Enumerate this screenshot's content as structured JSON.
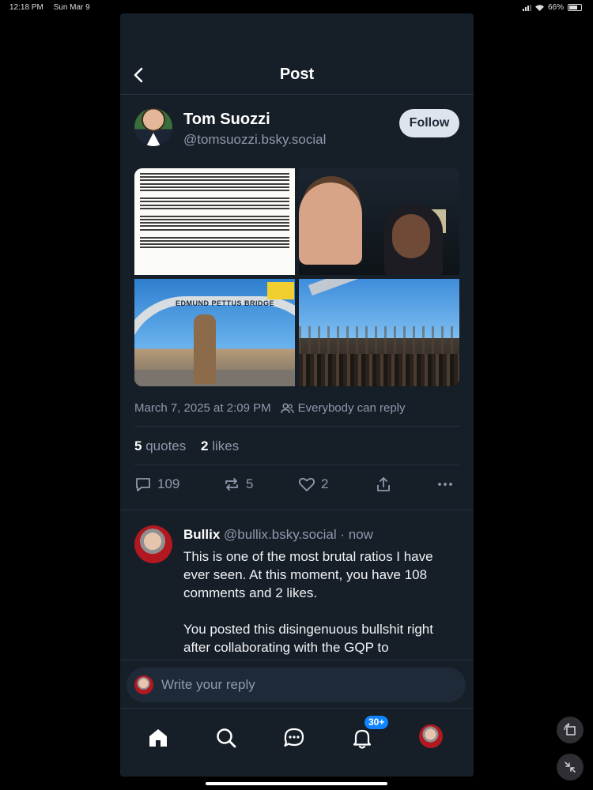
{
  "status_bar": {
    "time": "12:18 PM",
    "date": "Sun Mar 9",
    "battery": "66%"
  },
  "header": {
    "title": "Post"
  },
  "author": {
    "name": "Tom Suozzi",
    "handle": "@tomsuozzi.bsky.social",
    "follow_label": "Follow"
  },
  "images": {
    "bridge_sign": "EDMUND PETTUS BRIDGE"
  },
  "post_meta": {
    "timestamp": "March 7, 2025 at 2:09 PM",
    "reply_setting": "Everybody can reply"
  },
  "stats": {
    "quotes_count": "5",
    "quotes_label": "quotes",
    "likes_count": "2",
    "likes_label": "likes"
  },
  "actions": {
    "replies": "109",
    "reposts": "5",
    "likes": "2"
  },
  "reply": {
    "name": "Bullix",
    "handle": "@bullix.bsky.social",
    "time": "· now",
    "text": "This is one of the most brutal ratios I have ever seen. At this moment, you have 108 comments and 2 likes.\n\nYou posted this disingenuous bullshit right after collaborating with the GQP to"
  },
  "composer": {
    "placeholder": "Write your reply"
  },
  "tabbar": {
    "notifications_badge": "30+"
  },
  "colors": {
    "background": "#161e27",
    "accent": "#1083fe",
    "muted": "#8e9bad"
  }
}
